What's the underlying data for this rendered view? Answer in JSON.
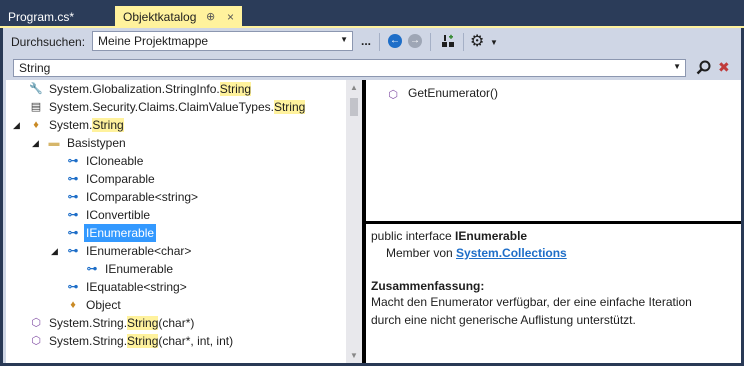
{
  "tabs": {
    "inactive": "Program.cs*",
    "active": "Objektkatalog",
    "pin_glyph": "⊕",
    "close_glyph": "×"
  },
  "toolbar": {
    "browse_label": "Durchsuchen:",
    "scope_value": "Meine Projektmappe",
    "ellipsis": "...",
    "back_glyph": "←",
    "forward_glyph": "→",
    "settings_glyph": "⚙"
  },
  "search": {
    "value": "String"
  },
  "tree": {
    "items": [
      {
        "prefix": "System.Globalization.StringInfo.",
        "match": "String",
        "suffix": "",
        "icon": "wrench-icon",
        "glyph": "🔧"
      },
      {
        "prefix": "System.Security.Claims.ClaimValueTypes.",
        "match": "String",
        "suffix": "",
        "icon": "field-icon",
        "glyph": "▤"
      },
      {
        "prefix": "System.",
        "match": "String",
        "suffix": "",
        "icon": "class-icon",
        "glyph": "♦"
      },
      {
        "label": "Basistypen",
        "icon": "folder-icon",
        "glyph": "▬"
      },
      {
        "label": "ICloneable",
        "icon": "interface-icon",
        "glyph": "⊶"
      },
      {
        "label": "IComparable",
        "icon": "interface-icon",
        "glyph": "⊶"
      },
      {
        "label": "IComparable<string>",
        "icon": "interface-icon",
        "glyph": "⊶"
      },
      {
        "label": "IConvertible",
        "icon": "interface-icon",
        "glyph": "⊶"
      },
      {
        "label": "IEnumerable",
        "icon": "interface-icon",
        "glyph": "⊶"
      },
      {
        "label": "IEnumerable<char>",
        "icon": "interface-icon",
        "glyph": "⊶"
      },
      {
        "label": "IEnumerable",
        "icon": "interface-icon",
        "glyph": "⊶"
      },
      {
        "label": "IEquatable<string>",
        "icon": "interface-icon",
        "glyph": "⊶"
      },
      {
        "label": "Object",
        "icon": "class-icon",
        "glyph": "♦"
      },
      {
        "prefix": "System.String.",
        "match": "String",
        "suffix": "(char*)",
        "icon": "method-icon",
        "glyph": "⬡"
      },
      {
        "prefix": "System.String.",
        "match": "String",
        "suffix": "(char*, int, int)",
        "icon": "method-icon",
        "glyph": "⬡"
      }
    ]
  },
  "members": {
    "items": [
      {
        "label": "GetEnumerator()",
        "glyph": "⬡"
      }
    ]
  },
  "details": {
    "signature_prefix": "public interface ",
    "signature_name": "IEnumerable",
    "member_of_prefix": "Member von ",
    "member_of_link": "System.Collections",
    "summary_heading": "Zusammenfassung:",
    "summary_line1": "Macht den Enumerator verfügbar, der eine einfache Iteration",
    "summary_line2": "durch eine nicht generische Auflistung unterstützt."
  }
}
